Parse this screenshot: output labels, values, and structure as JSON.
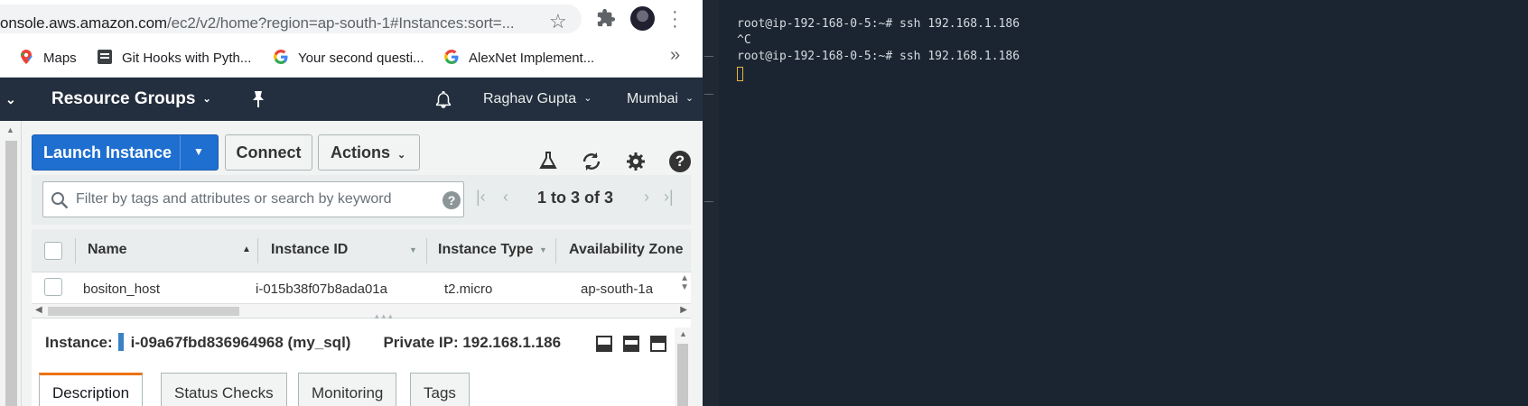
{
  "browser": {
    "url_main": "onsole.aws.amazon.com",
    "url_rest": "/ec2/v2/home?region=ap-south-1#Instances:sort=...",
    "bookmarks": [
      {
        "label": "Maps",
        "icon": "maps-icon"
      },
      {
        "label": "Git Hooks with Pyth...",
        "icon": "bookmark-icon"
      },
      {
        "label": "Your second questi...",
        "icon": "google-icon"
      },
      {
        "label": "AlexNet Implement...",
        "icon": "google-icon"
      }
    ],
    "more": "»"
  },
  "aws_nav": {
    "resource_groups": "Resource Groups",
    "user": "Raghav Gupta",
    "region": "Mumbai"
  },
  "toolbar": {
    "launch": "Launch Instance",
    "connect": "Connect",
    "actions": "Actions"
  },
  "filter": {
    "placeholder": "Filter by tags and attributes or search by keyword",
    "help": "?",
    "pagination": "1 to 3 of 3"
  },
  "table": {
    "columns": [
      "Name",
      "Instance ID",
      "Instance Type",
      "Availability Zone"
    ],
    "rows": [
      {
        "name": "bositon_host",
        "instance_id": "i-015b38f07b8ada01a",
        "instance_type": "t2.micro",
        "zone": "ap-south-1a"
      }
    ]
  },
  "detail": {
    "label": "Instance:",
    "instance": "i-09a67fbd836964968 (my_sql)",
    "private_ip": "Private IP: 192.168.1.186",
    "tabs": [
      "Description",
      "Status Checks",
      "Monitoring",
      "Tags"
    ],
    "active_tab": "Description"
  },
  "terminal": {
    "lines": [
      "root@ip-192-168-0-5:~# ssh 192.168.1.186",
      "^C",
      "root@ip-192-168-0-5:~# ssh 192.168.1.186"
    ]
  },
  "colors": {
    "aws_nav": "#232f3e",
    "primary_button": "#1f6fd0",
    "active_tab_accent": "#ec7211",
    "terminal_bg": "#1b2531",
    "cursor": "#e5b33f"
  }
}
